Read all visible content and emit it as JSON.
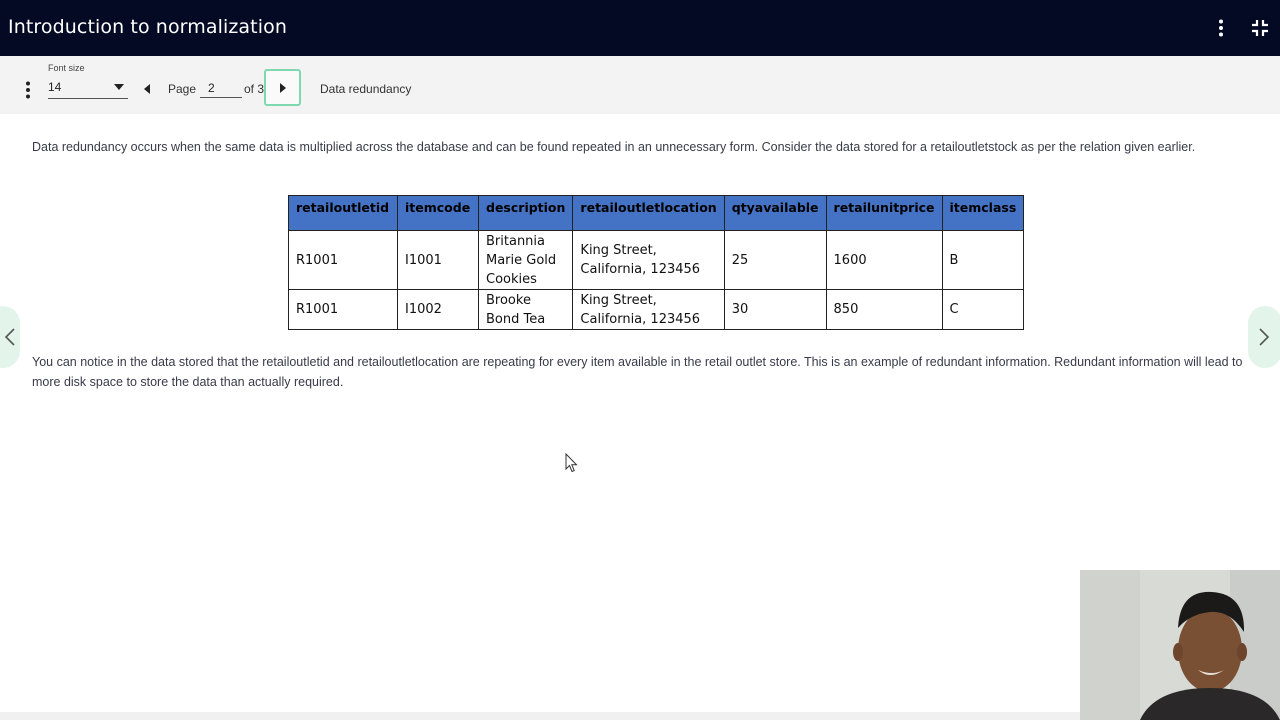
{
  "app": {
    "title": "Introduction to normalization"
  },
  "toolbar": {
    "font_size_label": "Font size",
    "font_size_value": "14",
    "page_label": "Page",
    "page_value": "2",
    "page_of": "of 3",
    "section_title": "Data redundancy"
  },
  "content": {
    "paragraph1": "Data redundancy occurs when the same data is multiplied across the database and can be found repeated in an unnecessary form. Consider the data stored for a retailoutletstock as per the relation given earlier.",
    "paragraph2": "You can notice in the data stored that the retailoutletid and retailoutletlocation are repeating for every item available in the retail outlet store. This is an example of redundant information. Redundant information will lead to more disk space to store the data than actually required.",
    "table": {
      "headers": [
        "retailoutletid",
        "itemcode",
        "description",
        "retailoutletlocation",
        "qtyavailable",
        "retailunitprice",
        "itemclass"
      ],
      "rows": [
        [
          "R1001",
          "I1001",
          "Britannia Marie Gold Cookies",
          "King Street, California, 123456",
          "25",
          "1600",
          "B"
        ],
        [
          "R1001",
          "I1002",
          "Brooke Bond Tea",
          "King Street, California, 123456",
          "30",
          "850",
          "C"
        ]
      ]
    }
  },
  "icons": {
    "title_more": "more-vertical-icon",
    "title_collapse": "collapse-fullscreen-icon",
    "toolbar_more": "more-vertical-icon",
    "prev_page": "caret-left-icon",
    "next_page": "caret-right-icon",
    "side_prev": "chevron-left-icon",
    "side_next": "chevron-right-icon"
  },
  "colors": {
    "titlebar_bg": "#050a24",
    "table_header_bg": "#4472c4",
    "next_button_border": "#7fd8b0",
    "side_arrow_bg": "#e3f5ea"
  }
}
